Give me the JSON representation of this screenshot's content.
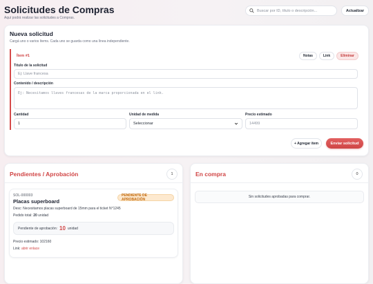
{
  "header": {
    "title": "Solicitudes de Compras",
    "subtitle": "Aquí podrá realizar las solicitudes a Compras.",
    "search_placeholder": "Buscar por ID, título o descripción...",
    "refresh_label": "Actualizar"
  },
  "new_request": {
    "title": "Nueva solicitud",
    "subtitle": "Cargá uno o varios ítems. Cada uno se guarda como una línea independiente.",
    "item": {
      "tag": "Ítem #1",
      "notes_label": "Notas",
      "link_label": "Link",
      "delete_label": "Eliminar",
      "title_label": "Título de la solicitud",
      "title_placeholder": "Ej: Llave francesa",
      "content_label": "Contenido / descripción",
      "content_placeholder": "Ej: Necesitamos llaves francesas de la marca proporcionada en el link.",
      "quantity_label": "Cantidad",
      "quantity_value": "1",
      "unit_label": "Unidad de medida",
      "unit_value": "Seleccionar",
      "price_label": "Precio estimado",
      "price_placeholder": "14499"
    },
    "add_item_label": "+ Agregar ítem",
    "send_label": "Enviar solicitud"
  },
  "pending": {
    "title": "Pendientes / Aprobación",
    "count": "1",
    "title_color": "#d04545",
    "request": {
      "id": "SOL-000003",
      "title": "Placas superboard",
      "status": "PENDIENTE DE APROBACIÓN",
      "desc_label": "Desc:",
      "desc": "Necesitamos placas superboard de 15mm para el ticket N°1245",
      "total_label": "Pedido total:",
      "total_qty": "20",
      "total_unit": "unidad",
      "pending_label": "Pendiente de aprobación:",
      "pending_qty": "10",
      "pending_unit": "unidad",
      "price_label": "Precio estimado:",
      "price": "102160",
      "link_label": "Link:",
      "link_text": "abrir enlace"
    }
  },
  "buying": {
    "title": "En compra",
    "count": "0",
    "title_color": "#d04545",
    "empty": "Sin solicitudes aprobadas para comprar."
  }
}
